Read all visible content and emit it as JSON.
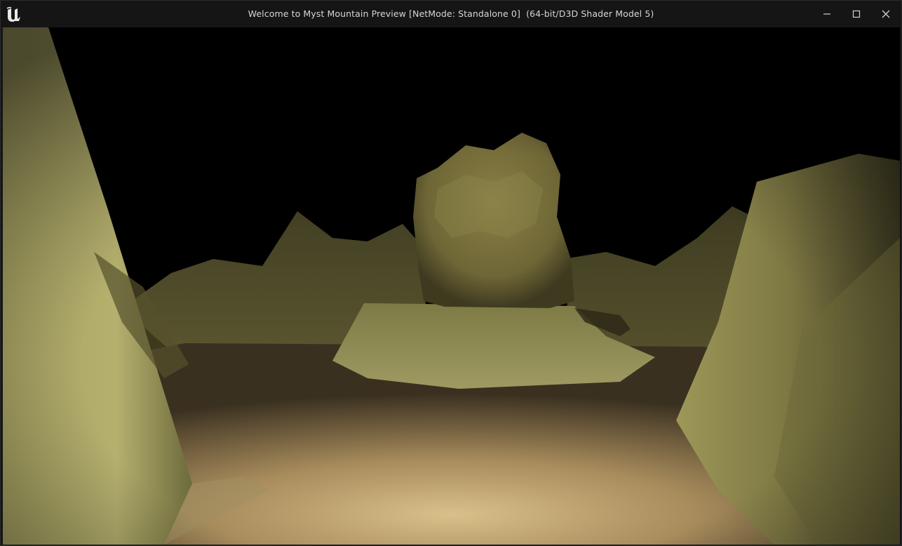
{
  "window": {
    "title": "Welcome to Myst Mountain Preview [NetMode: Standalone 0]  (64-bit/D3D Shader Model 5)",
    "logo_icon": "unreal-engine-logo-icon",
    "controls": {
      "minimize_icon": "minimize-icon",
      "maximize_icon": "maximize-icon",
      "close_icon": "close-icon"
    }
  },
  "colors": {
    "titlebar": "#151515",
    "title_text": "#d6d6d6",
    "sky": "#000000",
    "rock_yellow": "#8f8a4a",
    "sand": "#b9a06e"
  }
}
